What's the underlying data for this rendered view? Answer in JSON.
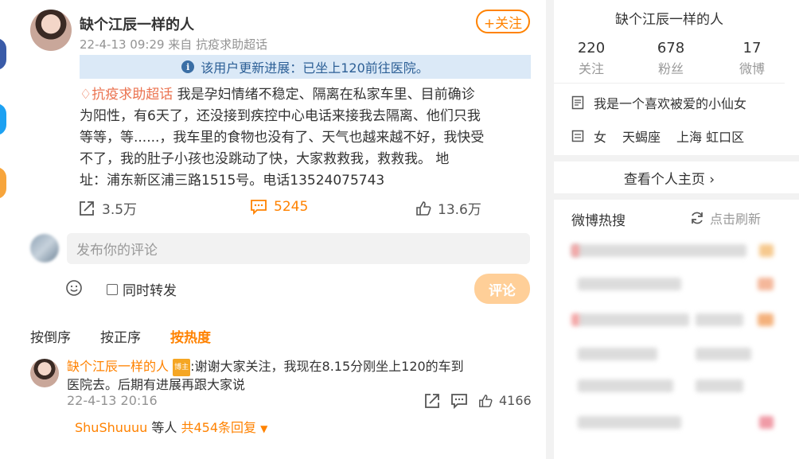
{
  "post": {
    "author": "缺个江辰一样的人",
    "meta": "22-4-13 09:29 来自 抗疫求助超话",
    "follow_label": "+关注",
    "notice": "该用户更新进展：已坐上120前往医院。",
    "topic_tag": "♢抗疫求助超话",
    "body_line1": " 我是孕妇情绪不稳定、隔离在私家车里、目前确诊",
    "body_line2": "为阳性，有6天了，还没接到疾控中心电话来接我去隔离、他们只我",
    "body_line3": "等等，等......，我车里的食物也没有了、天气也越来越不好，我快受",
    "body_line4": "不了，我的肚子小孩也没跳动了快，大家救救我，救救我。        地",
    "body_line5": "址：浦东新区浦三路1515号。电话13524075743",
    "reposts": "3.5万",
    "comments": "5245",
    "likes": "13.6万"
  },
  "compose": {
    "placeholder": "发布你的评论",
    "repost_label": "同时转发",
    "submit_label": "评论"
  },
  "sort": {
    "reverse": "按倒序",
    "forward": "按正序",
    "hot": "按热度"
  },
  "comment": {
    "author": "缺个江辰一样的人",
    "badge": "博主",
    "text_line1": ":谢谢大家关注，我现在8.15分刚坐上120的车到",
    "text_line2": "医院去。后期有进展再跟大家说",
    "time": "22-4-13 20:16",
    "likes": "4166",
    "replies_user": "ShuShuuuu",
    "replies_mid": " 等人 ",
    "replies_count": "共454条回复"
  },
  "profile": {
    "name": "缺个江辰一样的人",
    "follow_count": "220",
    "follow_label": "关注",
    "fans_count": "678",
    "fans_label": "粉丝",
    "weibo_count": "17",
    "weibo_label": "微博",
    "bio": "我是一个喜欢被爱的小仙女",
    "gender": "女",
    "zodiac": "天蝎座",
    "location": "上海 虹口区",
    "view_profile": "查看个人主页 ›"
  },
  "hot": {
    "title": "微博热搜",
    "refresh": "点击刷新"
  },
  "colors": {
    "accent": "#ff8200",
    "notice_bg": "#dbe9f7",
    "tag": "#eb7350"
  }
}
